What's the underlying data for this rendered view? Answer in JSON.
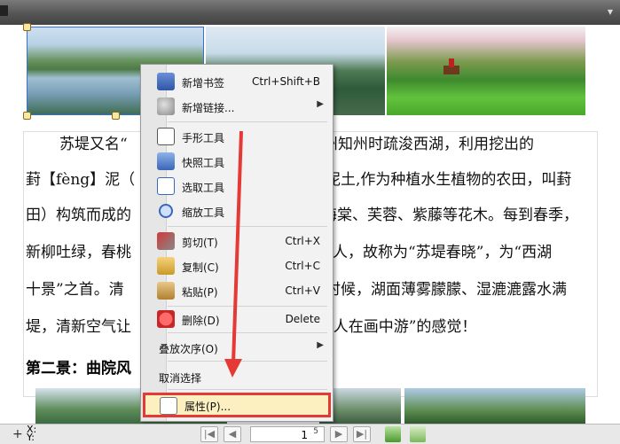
{
  "document": {
    "paragraph_lines": [
      "苏堤又名“",
      "杭州知州时疏浚西湖，利用挖出的",
      "葑【fèng】泥（",
      "泥土,作为种植水生植物的农田，叫葑",
      "田）构筑而成的",
      "海棠、芙蓉、紫藤等花木。每到春季，",
      "新柳吐绿，春桃",
      "人，故称为“苏堤春晓”，为“西湖",
      "十景”之首。清",
      "时候，湖面薄雾朦朦、湿漉漉露水满",
      "堤，清新空气让",
      "“人在画中游”的感觉！"
    ],
    "heading": "第二景：曲院风"
  },
  "context_menu": {
    "items": [
      {
        "label": "新增书签",
        "shortcut": "Ctrl+Shift+B",
        "icon": "bookmark-add-icon"
      },
      {
        "label": "新增链接...",
        "shortcut": "",
        "icon": "link-add-icon",
        "submenu": true
      },
      {
        "label": "手形工具",
        "shortcut": "",
        "icon": "hand-tool-icon"
      },
      {
        "label": "快照工具",
        "shortcut": "",
        "icon": "camera-icon"
      },
      {
        "label": "选取工具",
        "shortcut": "",
        "icon": "text-select-icon"
      },
      {
        "label": "缩放工具",
        "shortcut": "",
        "icon": "zoom-icon"
      },
      {
        "label": "剪切(T)",
        "shortcut": "Ctrl+X",
        "icon": "scissors-icon"
      },
      {
        "label": "复制(C)",
        "shortcut": "Ctrl+C",
        "icon": "copy-icon"
      },
      {
        "label": "粘贴(P)",
        "shortcut": "Ctrl+V",
        "icon": "paste-icon"
      },
      {
        "label": "删除(D)",
        "shortcut": "Delete",
        "icon": "delete-icon"
      },
      {
        "label": "叠放次序(O)",
        "shortcut": "",
        "icon": "",
        "submenu": true
      },
      {
        "label": "取消选择",
        "shortcut": "",
        "icon": ""
      },
      {
        "label": "属性(P)...",
        "shortcut": "",
        "icon": "properties-icon",
        "highlighted": true
      }
    ],
    "submenu_glyph": "▶"
  },
  "statusbar": {
    "x_label": "X:",
    "y_label": "Y:",
    "current_page": "1",
    "total_pages": "5"
  },
  "colors": {
    "highlight_border": "#e53935",
    "highlight_fill": "#fdf0c0",
    "annotation_arrow": "#e53935"
  }
}
